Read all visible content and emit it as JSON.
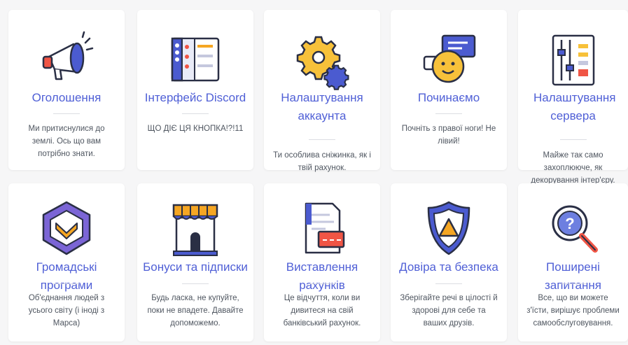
{
  "cards": [
    {
      "title": "Оголошення",
      "desc": "Ми притиснулися до землі. Ось що вам потрібно знати.",
      "icon": "megaphone-icon"
    },
    {
      "title": "Інтерфейс Discord",
      "desc": "ЩО ДІЄ ЦЯ КНОПКА!?!11",
      "icon": "interface-window-icon"
    },
    {
      "title": "Налаштування аккаунта",
      "desc": "Ти особлива сніжинка, як і твій рахунок.",
      "icon": "gears-icon"
    },
    {
      "title": "Починаємо",
      "desc": "Почніть з правої ноги! Не лівий!",
      "icon": "smiley-chat-icon"
    },
    {
      "title": "Налаштування сервера",
      "desc": "Майже так само захоплююче, як декорування інтер'єру.",
      "icon": "server-sliders-icon"
    },
    {
      "title": "Громадські програми",
      "desc": "Об'єднання людей з усього світу (і іноді з Марса)",
      "icon": "community-badge-icon"
    },
    {
      "title": "Бонуси та підписки",
      "desc": "Будь ласка, не купуйте, поки не впадете. Давайте допоможемо.",
      "icon": "storefront-icon"
    },
    {
      "title": "Виставлення рахунків",
      "desc": "Це відчуття, коли ви дивитеся на свій банківський рахунок.",
      "icon": "invoice-card-icon"
    },
    {
      "title": "Довіра та безпека",
      "desc": "Зберігайте речі в цілості й здорові для себе та ваших друзів.",
      "icon": "shield-icon"
    },
    {
      "title": "Поширені запитання",
      "desc": "Все, що ви можете з'їсти, вирішує проблеми самообслуговування.",
      "icon": "question-magnifier-icon"
    }
  ],
  "colors": {
    "title": "#4f5fd6",
    "text": "#4f5660",
    "card": "#ffffff",
    "background": "#f6f6f7"
  }
}
